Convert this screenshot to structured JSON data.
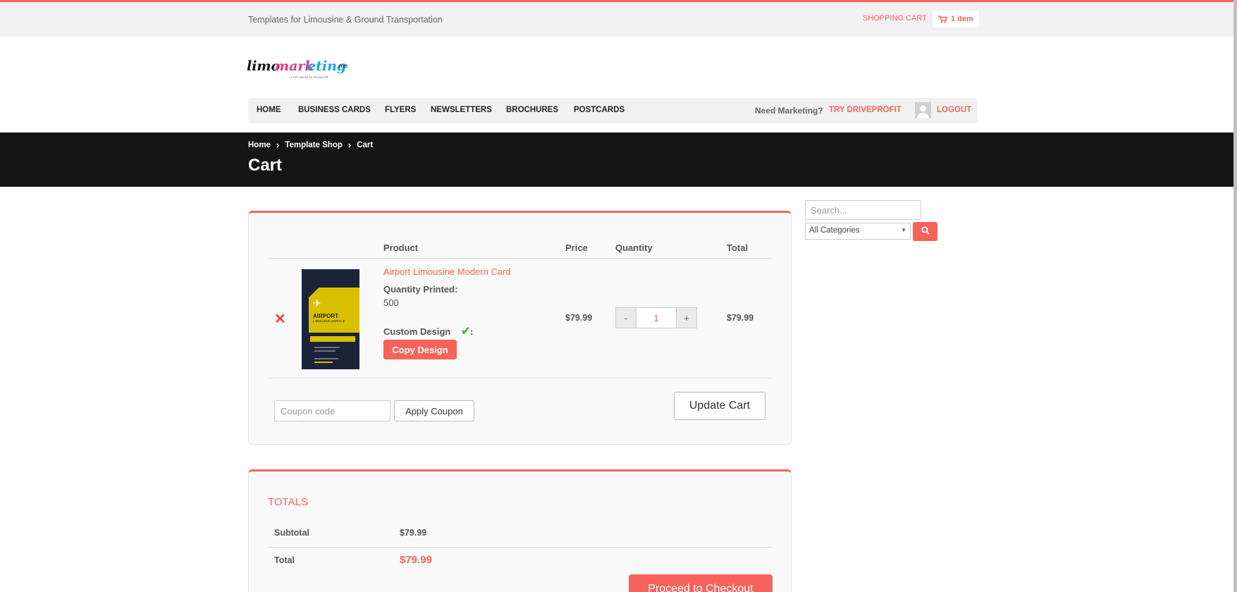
{
  "topbar": {
    "tagline": "Templates for Limousine & Ground Transportation",
    "cart_link": "SHOPPING CART",
    "cart_count": "1 item"
  },
  "logo": {
    "text": "limomarketing",
    "suffix": ".me",
    "byline": "a site owned by driveprofit"
  },
  "nav": {
    "items": [
      "HOME",
      "BUSINESS CARDS",
      "FLYERS",
      "NEWSLETTERS",
      "BROCHURES",
      "POSTCARDS"
    ],
    "need_marketing": "Need Marketing?",
    "try_label": "TRY DRIVEPROFIT",
    "logout_label": "LOGOUT"
  },
  "breadcrumb": [
    "Home",
    "Template Shop",
    "Cart"
  ],
  "page_title": "Cart",
  "cart": {
    "headers": {
      "product": "Product",
      "price": "Price",
      "quantity": "Quantity",
      "total": "Total"
    },
    "item": {
      "name": "Airport Limousine Modern Card",
      "qty_printed_label": "Quantity Printed:",
      "qty_printed_value": "500",
      "custom_design_label": "Custom Design",
      "copy_button": "Copy Design",
      "price": "$79.99",
      "quantity": "1",
      "total": "$79.99",
      "thumb_title": "AIRPORT",
      "thumb_subtitle": "LIMOUSINE SERVICE"
    },
    "coupon_placeholder": "Coupon code",
    "apply_coupon": "Apply Coupon",
    "update_cart": "Update Cart"
  },
  "totals": {
    "title": "TOTALS",
    "subtotal_label": "Subtotal",
    "subtotal_value": "$79.99",
    "total_label": "Total",
    "total_value": "$79.99",
    "checkout": "Proceed to Checkout"
  },
  "sidebar": {
    "search_placeholder": "Search...",
    "category_selected": "All Categories"
  },
  "colors": {
    "accent": "#f6635b",
    "dark_band": "#151515",
    "light_bg": "#f1f1f1"
  }
}
